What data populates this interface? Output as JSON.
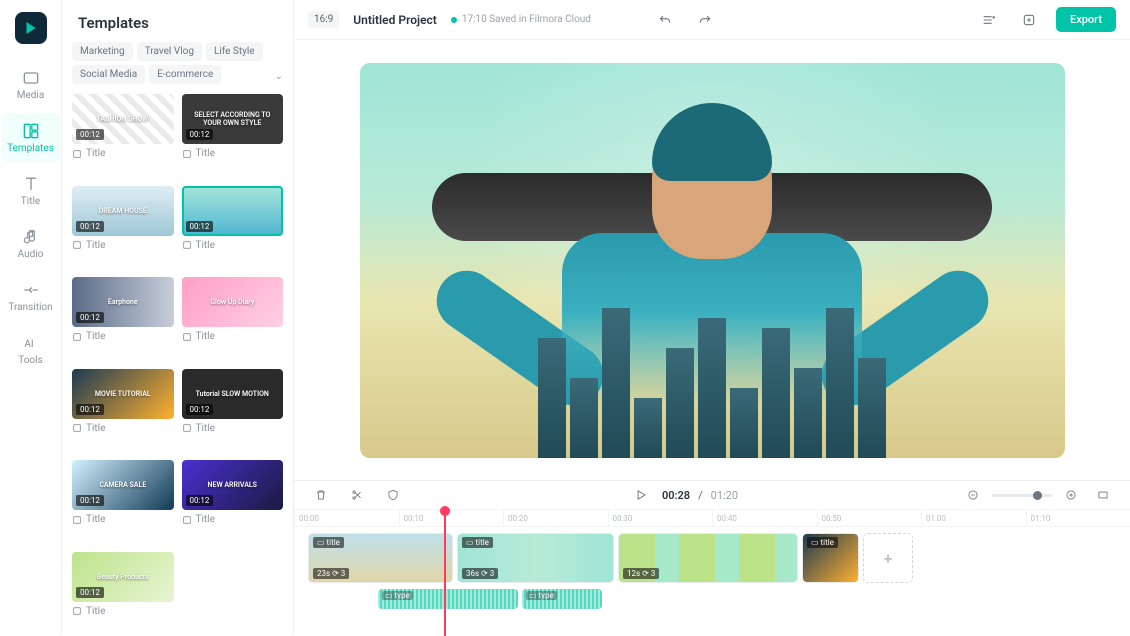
{
  "rail": {
    "items": [
      {
        "id": "media",
        "label": "Media"
      },
      {
        "id": "templates",
        "label": "Templates"
      },
      {
        "id": "title",
        "label": "Title"
      },
      {
        "id": "audio",
        "label": "Audio"
      },
      {
        "id": "transition",
        "label": "Transition"
      },
      {
        "id": "tools",
        "label": "Tools"
      }
    ]
  },
  "panel": {
    "title": "Templates",
    "tags": [
      "Marketing",
      "Travel Vlog",
      "Life Style",
      "Social Media",
      "E-commerce"
    ],
    "templates": [
      {
        "dur": "00:12",
        "label": "Title",
        "overlay": "FASHION SHOW"
      },
      {
        "dur": "00:12",
        "label": "Title",
        "overlay": "SELECT ACCORDING TO YOUR OWN STYLE"
      },
      {
        "dur": "00:12",
        "label": "Title",
        "overlay": "DREAM HOUSE"
      },
      {
        "dur": "00:12",
        "label": "Title",
        "overlay": "",
        "selected": true
      },
      {
        "dur": "00:12",
        "label": "Title",
        "overlay": "Earphone"
      },
      {
        "dur": "",
        "label": "Title",
        "overlay": "Glow Up Diary"
      },
      {
        "dur": "00:12",
        "label": "Title",
        "overlay": "MOVIE TUTORIAL"
      },
      {
        "dur": "00:12",
        "label": "Title",
        "overlay": "Tutorial SLOW MOTION"
      },
      {
        "dur": "00:12",
        "label": "Title",
        "overlay": "CAMERA SALE"
      },
      {
        "dur": "00:12",
        "label": "Title",
        "overlay": "NEW ARRIVALS"
      },
      {
        "dur": "00:12",
        "label": "Title",
        "overlay": "Beauty Products"
      }
    ]
  },
  "topbar": {
    "ratio": "16:9",
    "project_title": "Untitled Project",
    "save_status": "17:10 Saved in Filmora Cloud",
    "export": "Export"
  },
  "timeline": {
    "current": "00:28",
    "duration": "01:20",
    "ticks": [
      "00:00",
      "00:10",
      "00:20",
      "00:30",
      "00:40",
      "00:50",
      "01:00",
      "01:10"
    ],
    "clips": [
      {
        "badge": "title",
        "dur": "23s",
        "extra": "3"
      },
      {
        "badge": "title",
        "dur": "36s",
        "extra": "3"
      },
      {
        "badge": "",
        "dur": "12s",
        "extra": "3"
      },
      {
        "badge": "title",
        "dur": "",
        "extra": ""
      }
    ],
    "audio": [
      {
        "label": "type"
      },
      {
        "label": "type"
      }
    ]
  },
  "buildings": [
    120,
    80,
    150,
    60,
    110,
    140,
    70,
    130,
    90,
    150,
    100
  ]
}
